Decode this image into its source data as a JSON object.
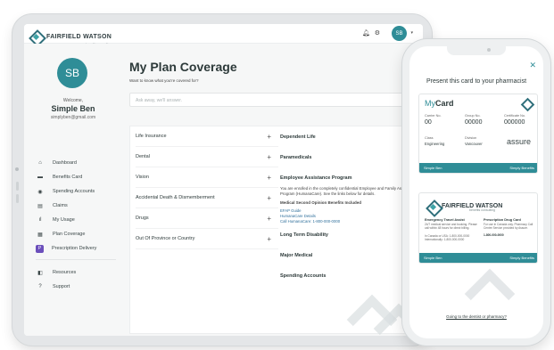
{
  "brand": {
    "name": "FAIRFIELD WATSON",
    "tagline": "benefits consulting"
  },
  "header": {
    "avatar_initials": "SB",
    "bell_icon": "bell-icon",
    "gear_icon": "gear-icon"
  },
  "profile": {
    "initials": "SB",
    "welcome": "Welcome,",
    "name": "Simple Ben",
    "email": "simplyben@gmail.com"
  },
  "nav": {
    "items": [
      {
        "icon": "home-icon",
        "glyph": "⌂",
        "label": "Dashboard"
      },
      {
        "icon": "card-icon",
        "glyph": "▬",
        "label": "Benefits Card"
      },
      {
        "icon": "dollar-icon",
        "glyph": "◉",
        "label": "Spending Accounts"
      },
      {
        "icon": "document-icon",
        "glyph": "▤",
        "label": "Claims"
      },
      {
        "icon": "chart-icon",
        "glyph": "ıl",
        "label": "My Usage"
      },
      {
        "icon": "shield-icon",
        "glyph": "▦",
        "label": "Plan Coverage"
      },
      {
        "icon": "prescription-icon",
        "glyph": "P",
        "label": "Prescription Delivery"
      }
    ],
    "secondary": [
      {
        "icon": "book-icon",
        "glyph": "◧",
        "label": "Resources"
      },
      {
        "icon": "help-icon",
        "glyph": "?",
        "label": "Support"
      }
    ]
  },
  "main": {
    "title": "My Plan Coverage",
    "question": "Want to know what you're covered for?",
    "search_placeholder": "Ask away, we'll answer.",
    "left_sections": [
      "Life Insurance",
      "Dental",
      "Vision",
      "Accidental Death & Dismemberment",
      "Drugs",
      "Out Of Province or Country"
    ],
    "right_sections": [
      "Dependent Life",
      "Paramedicals",
      "Employee Assistance Program",
      "Long Term Disability",
      "Major Medical",
      "Spending Accounts"
    ],
    "eap_text": "You are enrolled in the completely confidential Employee and Family Assistance Program (HumanaCare). See the links below for details.",
    "eap_sub": "Medical Second Opinion Benefits Included",
    "eap_links": [
      "EFAP Guide",
      "HumanaCare Details",
      "Call HumanaCare: 1-800-000-0000"
    ]
  },
  "phone": {
    "present_text": "Present this card to your pharmacist",
    "card1": {
      "title_prefix": "My",
      "title_suffix": "Card",
      "fields": [
        {
          "label": "Carrier No.",
          "value": "00"
        },
        {
          "label": "Group No.",
          "value": "00000"
        },
        {
          "label": "Certificate No.",
          "value": "000000"
        },
        {
          "label": "Class",
          "value": "Engineering"
        },
        {
          "label": "Division",
          "value": "Vancouver"
        }
      ],
      "carrier_logo": "assure",
      "footer_left": "Simple Ben",
      "footer_right": "Simply Benefits"
    },
    "card2": {
      "emergency_title": "Emergency Travel Assist",
      "emergency_text": "24/7 medical service and booking. Please call within 48 hours for direct billing.",
      "emergency_phone": "In Canada or USA: 1-800-000-0000",
      "emergency_intl": "Internationally: 1-800-000-0000",
      "drug_title": "Prescription Drug Card",
      "drug_text": "For use in Canada only. Pharmacy Call Centre Service provided by Assure.",
      "drug_phone": "1-800-000-0000",
      "footer_left": "Simple Ben",
      "footer_right": "Simply Benefits"
    },
    "dental_link": "Going to the dentist or pharmacy?"
  },
  "colors": {
    "accent": "#2f8d97",
    "prescription": "#6b4fbb",
    "link": "#2f6f9b"
  }
}
